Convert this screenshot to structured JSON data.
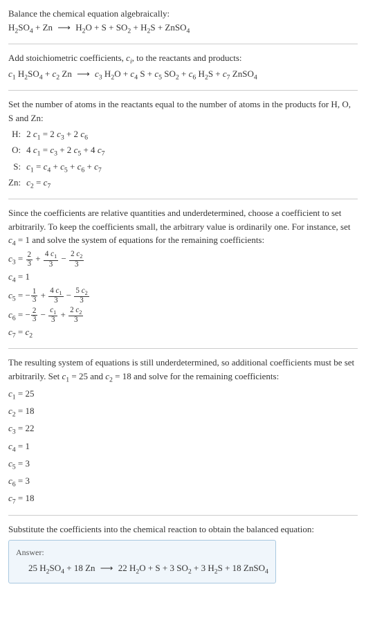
{
  "intro": {
    "line1": "Balance the chemical equation algebraically:",
    "eq_left": "H₂SO₄ + Zn",
    "eq_arrow": "⟶",
    "eq_right": "H₂O + S + SO₂ + H₂S + ZnSO₄"
  },
  "stoich": {
    "text": "Add stoichiometric coefficients, ",
    "ci": "c",
    "ci_sub": "i",
    "text2": ", to the reactants and products:",
    "eq": "c₁ H₂SO₄ + c₂ Zn ⟶ c₃ H₂O + c₄ S + c₅ SO₂ + c₆ H₂S + c₇ ZnSO₄"
  },
  "atoms": {
    "intro": "Set the number of atoms in the reactants equal to the number of atoms in the products for H, O, S and Zn:",
    "rows": [
      {
        "label": "H:",
        "eq": "2 c₁ = 2 c₃ + 2 c₆"
      },
      {
        "label": "O:",
        "eq": "4 c₁ = c₃ + 2 c₅ + 4 c₇"
      },
      {
        "label": "S:",
        "eq": "c₁ = c₄ + c₅ + c₆ + c₇"
      },
      {
        "label": "Zn:",
        "eq": "c₂ = c₇"
      }
    ]
  },
  "underdet1": {
    "text": "Since the coefficients are relative quantities and underdetermined, choose a coefficient to set arbitrarily. To keep the coefficients small, the arbitrary value is ordinarily one. For instance, set c₄ = 1 and solve the system of equations for the remaining coefficients:",
    "c3": {
      "lhs": "c₃ =",
      "t1n": "2",
      "t1d": "3",
      "plus1": " + ",
      "t2n": "4 c₁",
      "t2d": "3",
      "minus": " − ",
      "t3n": "2 c₂",
      "t3d": "3"
    },
    "c4": "c₄ = 1",
    "c5": {
      "lhs": "c₅ = −",
      "t1n": "1",
      "t1d": "3",
      "plus1": " + ",
      "t2n": "4 c₁",
      "t2d": "3",
      "minus": " − ",
      "t3n": "5 c₂",
      "t3d": "3"
    },
    "c6": {
      "lhs": "c₆ = −",
      "t1n": "2",
      "t1d": "3",
      "minus1": " − ",
      "t2n": "c₁",
      "t2d": "3",
      "plus": " + ",
      "t3n": "2 c₂",
      "t3d": "3"
    },
    "c7": "c₇ = c₂"
  },
  "underdet2": {
    "text": "The resulting system of equations is still underdetermined, so additional coefficients must be set arbitrarily. Set c₁ = 25 and c₂ = 18 and solve for the remaining coefficients:",
    "lines": [
      "c₁ = 25",
      "c₂ = 18",
      "c₃ = 22",
      "c₄ = 1",
      "c₅ = 3",
      "c₆ = 3",
      "c₇ = 18"
    ]
  },
  "final": {
    "text": "Substitute the coefficients into the chemical reaction to obtain the balanced equation:",
    "answer_label": "Answer:",
    "answer_eq": "25 H₂SO₄ + 18 Zn ⟶ 22 H₂O + S + 3 SO₂ + 3 H₂S + 18 ZnSO₄"
  }
}
